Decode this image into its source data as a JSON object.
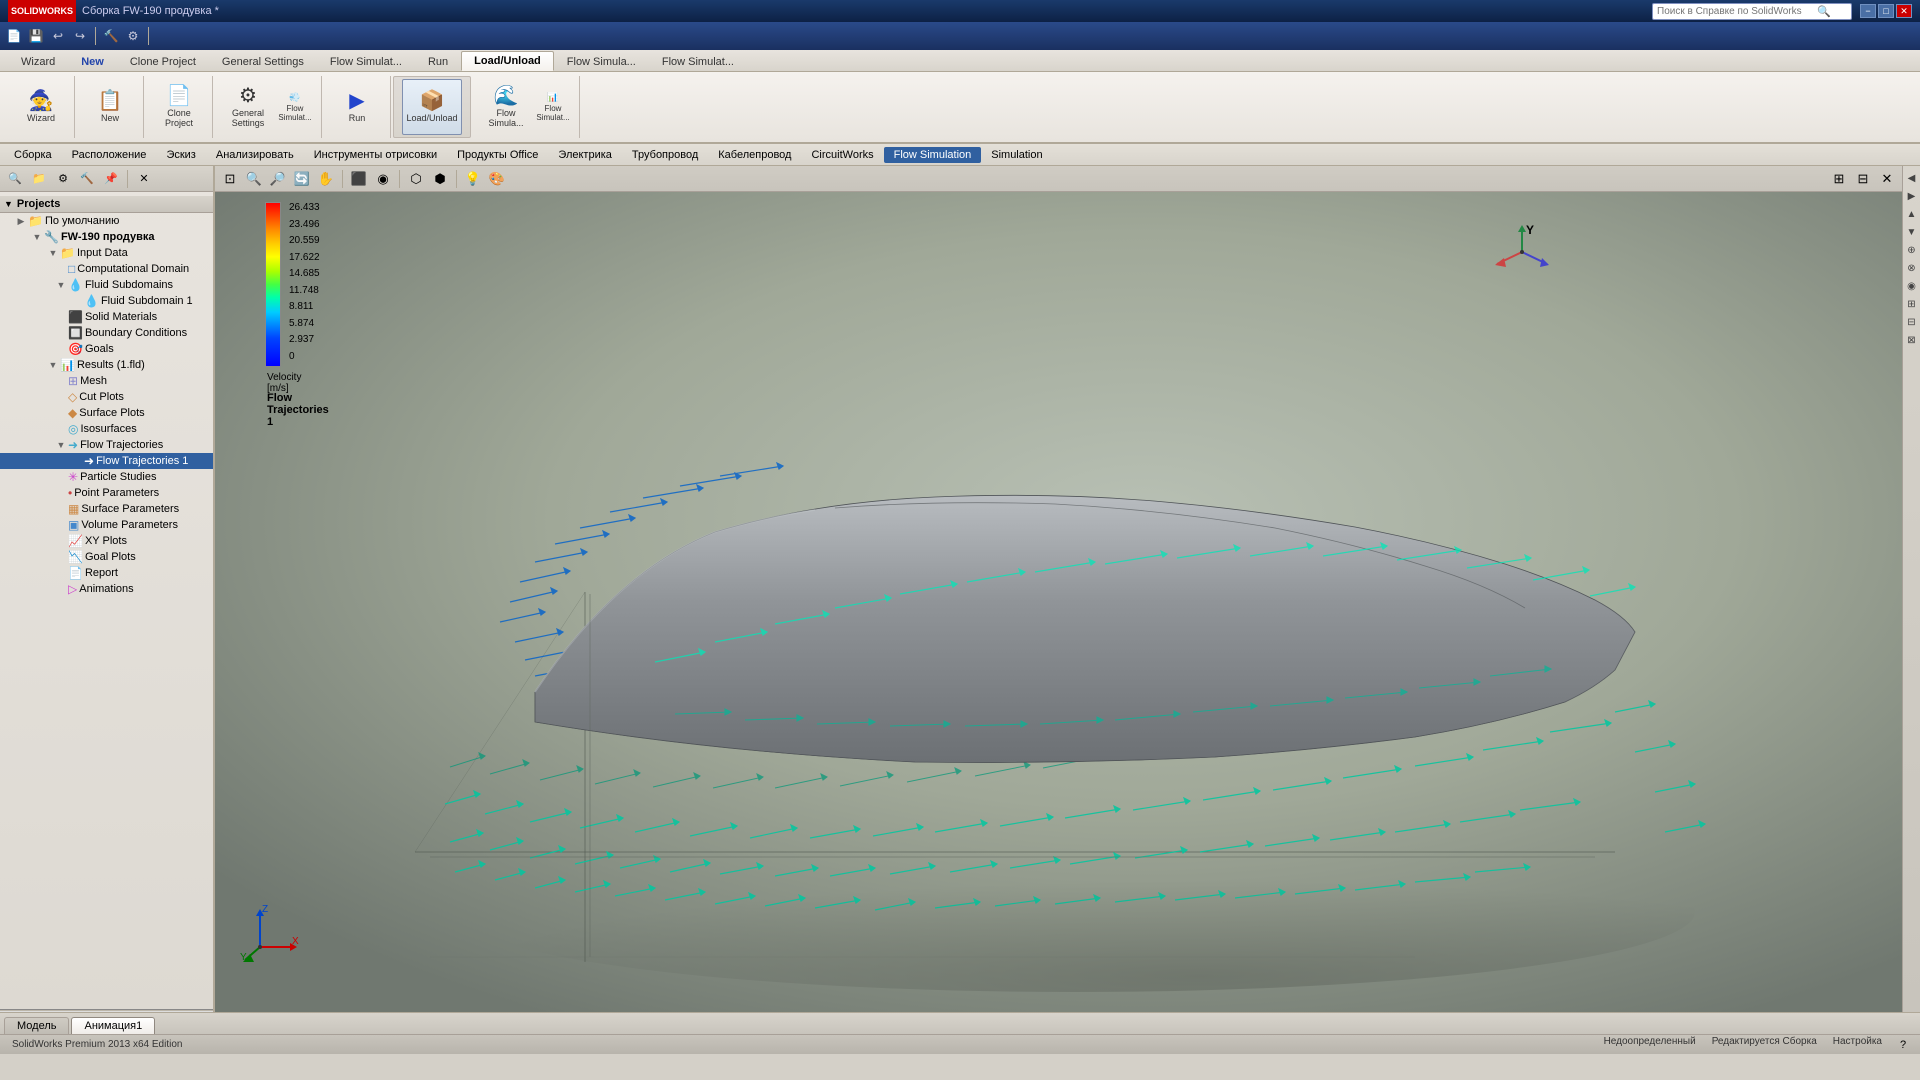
{
  "titlebar": {
    "title": "Сборка FW-190 продувка *",
    "search_placeholder": "Поиск в Справке по SolidWorks",
    "logo": "SOLIDWORKS",
    "min_label": "−",
    "max_label": "□",
    "close_label": "✕"
  },
  "quickaccess": {
    "buttons": [
      "📄",
      "💾",
      "↩",
      "↪",
      "▶",
      "◀"
    ]
  },
  "ribbon": {
    "tabs": [
      {
        "label": "Wizard",
        "active": false
      },
      {
        "label": "New",
        "active": false
      },
      {
        "label": "Clone Project",
        "active": false
      },
      {
        "label": "General Settings",
        "active": false
      },
      {
        "label": "Flow Simulat...",
        "active": false
      },
      {
        "label": "Run",
        "active": false
      },
      {
        "label": "Load/Unload",
        "active": true
      },
      {
        "label": "Flow Simula...",
        "active": false
      },
      {
        "label": "Flow Simulat...",
        "active": false
      }
    ]
  },
  "menubar": {
    "items": [
      {
        "label": "Сборка",
        "active": false
      },
      {
        "label": "Расположение",
        "active": false
      },
      {
        "label": "Эскиз",
        "active": false
      },
      {
        "label": "Анализировать",
        "active": false
      },
      {
        "label": "Инструменты отрисовки",
        "active": false
      },
      {
        "label": "Продукты Office",
        "active": false
      },
      {
        "label": "Электрика",
        "active": false
      },
      {
        "label": "Трубопровод",
        "active": false
      },
      {
        "label": "Кабелепровод",
        "active": false
      },
      {
        "label": "CircuitWorks",
        "active": false
      },
      {
        "label": "Flow Simulation",
        "active": true
      },
      {
        "label": "Simulation",
        "active": false
      }
    ]
  },
  "ribbon_buttons": [
    {
      "label": "Wizard",
      "icon": "🧙"
    },
    {
      "label": "New",
      "icon": "📋"
    },
    {
      "label": "Clone\nProject",
      "icon": "📄"
    },
    {
      "label": "General\nSettings",
      "icon": "⚙"
    },
    {
      "label": "Flow\nSimulat...",
      "icon": "💨"
    },
    {
      "label": "Run",
      "icon": "▶"
    },
    {
      "label": "Load/Unload",
      "icon": "📦"
    },
    {
      "label": "Flow\nSimula...",
      "icon": "🌊"
    },
    {
      "label": "Flow\nSimulat...",
      "icon": "📊"
    }
  ],
  "featuretree": {
    "projects_label": "Projects",
    "default_label": "По умолчанию",
    "fw190_label": "FW-190 продувка",
    "input_data_label": "Input Data",
    "comp_domain_label": "Computational Domain",
    "fluid_subdomains_label": "Fluid Subdomains",
    "fluid_subdomain1_label": "Fluid Subdomain 1",
    "solid_materials_label": "Solid Materials",
    "boundary_cond_label": "Boundary Conditions",
    "goals_label": "Goals",
    "results_label": "Results (1.fld)",
    "mesh_label": "Mesh",
    "cut_plots_label": "Cut Plots",
    "surface_plots_label": "Surface Plots",
    "isosurfaces_label": "Isosurfaces",
    "flow_traj_label": "Flow Trajectories",
    "flow_traj1_label": "Flow Trajectories 1",
    "particle_studies_label": "Particle Studies",
    "point_params_label": "Point Parameters",
    "surface_params_label": "Surface Parameters",
    "volume_params_label": "Volume Parameters",
    "xy_plots_label": "XY Plots",
    "goal_plots_label": "Goal Plots",
    "report_label": "Report",
    "animations_label": "Animations"
  },
  "colorscale": {
    "values": [
      "26.433",
      "23.496",
      "20.559",
      "17.622",
      "14.685",
      "11.748",
      "8.811",
      "5.874",
      "2.937",
      "0"
    ],
    "unit_label": "Velocity [m/s]",
    "plot_label": "Flow Trajectories 1"
  },
  "viewport": {
    "y_axis_label": "Y"
  },
  "statusbar": {
    "left_items": [
      {
        "label": "Недоопределенный"
      },
      {
        "label": "Редактируется Сборка"
      },
      {
        "label": "Настройка"
      }
    ],
    "sw_label": "SolidWorks Premium 2013 x64 Edition",
    "help_icon": "?"
  },
  "bottomtabs": {
    "tabs": [
      {
        "label": "Модель",
        "active": false
      },
      {
        "label": "Анимация1",
        "active": true
      }
    ]
  },
  "icons": {
    "expand": "▶",
    "collapse": "▼",
    "folder": "📁",
    "part": "🔷",
    "feature": "⬛",
    "check": "✓",
    "gear": "⚙",
    "flow": "💨",
    "plot": "📊"
  }
}
